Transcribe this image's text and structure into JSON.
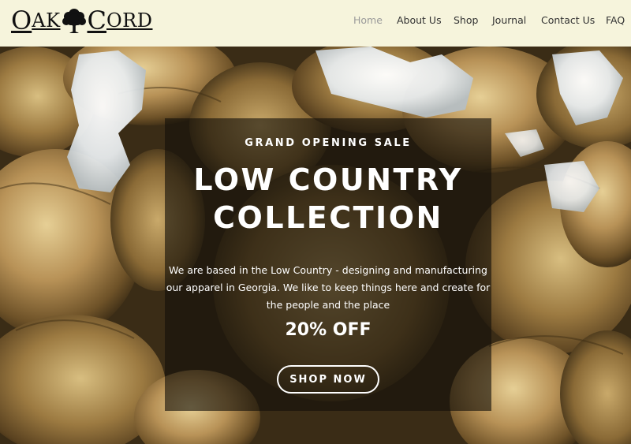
{
  "brand": {
    "logo_left_initial": "O",
    "logo_left_rest": "AK",
    "logo_right_initial": "C",
    "logo_right_rest": "ORD",
    "logo_icon": "oak-tree-icon"
  },
  "nav": {
    "items": [
      {
        "label": "Home",
        "active": true
      },
      {
        "label": "About Us",
        "active": false
      },
      {
        "label": "Shop",
        "active": false
      },
      {
        "label": "Journal",
        "active": false
      },
      {
        "label": "Contact Us",
        "active": false
      },
      {
        "label": "FAQ",
        "active": false
      }
    ]
  },
  "hero": {
    "background": "oysters-on-ice-photo",
    "eyebrow": "GRAND OPENING SALE",
    "title_line1": "LOW COUNTRY",
    "title_line2": "COLLECTION",
    "description_line1": "We are based in the Low Country - designing and manufacturing",
    "description_line2": "our apparel in Georgia. We like to keep things here and create for",
    "description_line3": "the people and the place",
    "discount": "20% OFF",
    "cta_label": "SHOP NOW"
  },
  "colors": {
    "header_bg": "#f6f4dc",
    "nav_text": "#333333",
    "nav_active": "#9a9a9a",
    "panel_overlay": "rgba(20,16,10,0.62)",
    "hero_text": "#ffffff"
  }
}
